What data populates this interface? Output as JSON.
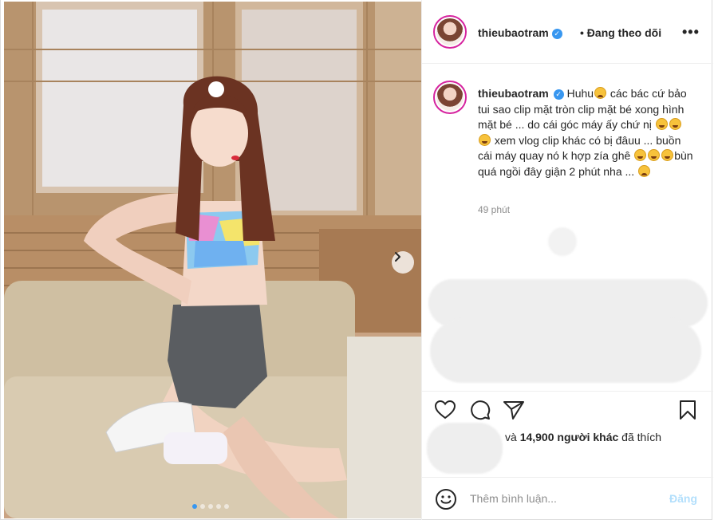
{
  "post": {
    "photo": {
      "alt_subject": "woman in tie-dye top on sofa",
      "carousel_total": 5,
      "carousel_active": 1
    },
    "header": {
      "username": "thieubaotram",
      "separator": "•",
      "follow_state": "Đang theo dõi",
      "more": "•••"
    },
    "caption": {
      "username": "thieubaotram",
      "text_1": "Huhu",
      "text_2": " các bác cứ bảo tui sao clip mặt tròn clip mặt bé xong hình mặt bé ... do cái góc máy ấy chứ nị ",
      "text_3": " xem vlog clip khác có bị đâuu ... buồn cái máy quay nó k hợp zía ghê ",
      "text_4": "bùn quá ngồi đây giận 2 phút nha ... ",
      "timestamp": "49 phút"
    },
    "actions": {
      "like_icon": "heart-icon",
      "comment_icon": "comment-bubble-icon",
      "share_icon": "paper-plane-icon",
      "save_icon": "bookmark-icon"
    },
    "likes": {
      "prefix": "và ",
      "count": "14,900 người khác",
      "suffix": " đã thích"
    },
    "comment": {
      "placeholder": "Thêm bình luận...",
      "post_label": "Đăng",
      "emoji_icon": "smiley-icon"
    },
    "colors": {
      "verified": "#3897f0",
      "post_button_disabled": "#b2dffc",
      "story_ring": "#d6249f",
      "timestamp": "#8e8e8e"
    }
  }
}
